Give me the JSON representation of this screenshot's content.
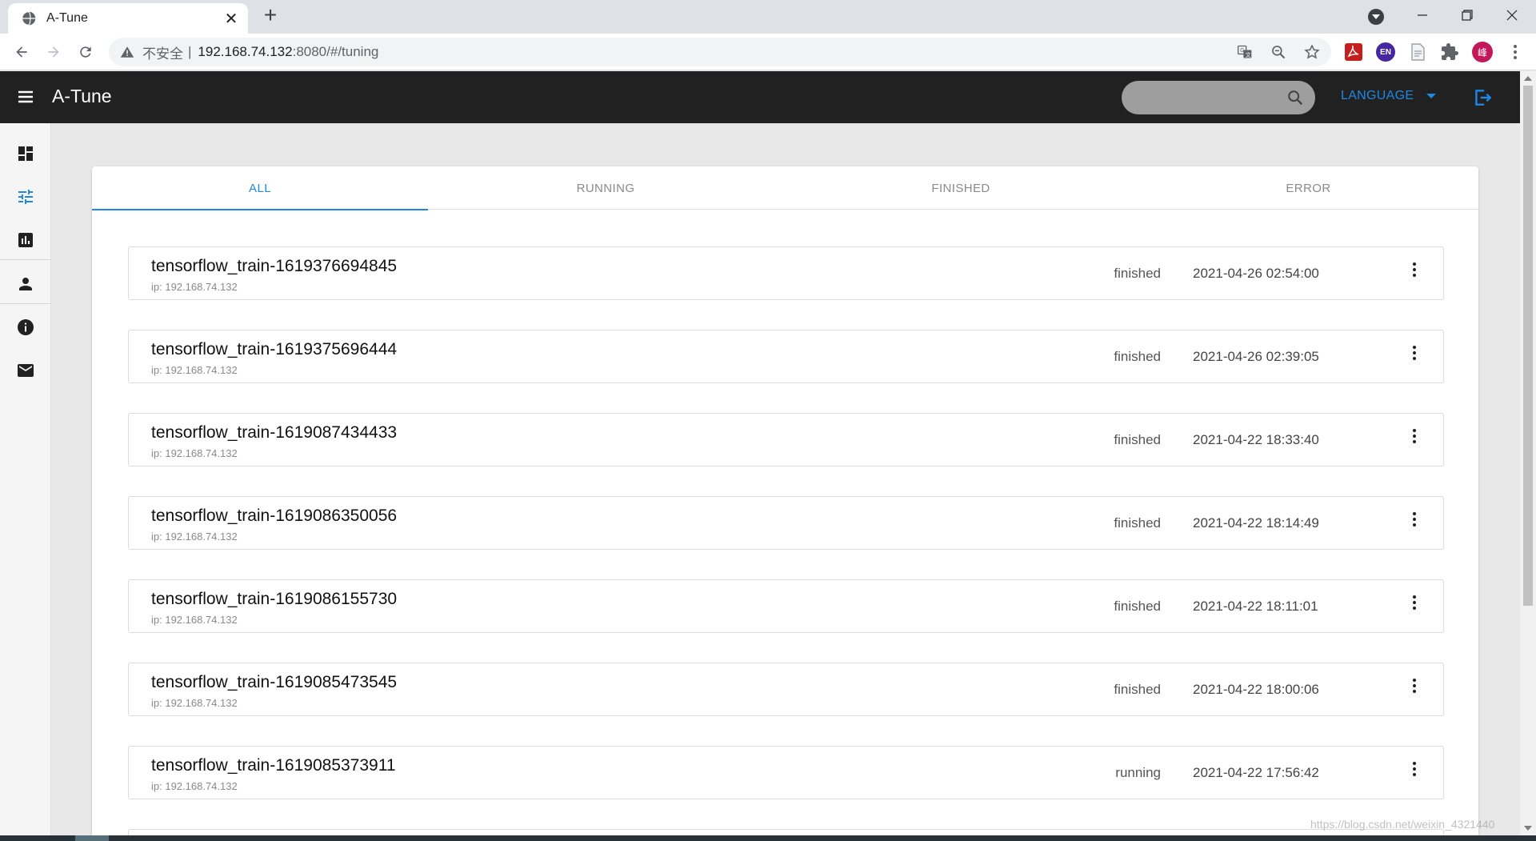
{
  "browser": {
    "tab_title": "A-Tune",
    "url_insecure_label": "不安全",
    "url_separator": "|",
    "url_host": "192.168.74.132",
    "url_path": ":8080/#/tuning",
    "icons": [
      "globe-icon",
      "close-icon",
      "plus-icon",
      "back-arrow-icon",
      "forward-arrow-icon",
      "reload-icon",
      "warning-icon",
      "translate-icon",
      "zoom-out-icon",
      "star-icon",
      "pdf-extension-icon",
      "en-extension-icon",
      "document-extension-icon",
      "puzzle-extension-icon",
      "profile-avatar",
      "more-vert-icon"
    ],
    "en_badge": "EN",
    "avatar_letter": "峰"
  },
  "app": {
    "title": "A-Tune",
    "language_label": "LANGUAGE",
    "sidebar_icons": [
      "dashboard-icon",
      "tune-icon",
      "chart-icon",
      "person-icon",
      "info-icon",
      "mail-icon"
    ]
  },
  "tabs": [
    {
      "label": "ALL",
      "active": true
    },
    {
      "label": "RUNNING",
      "active": false
    },
    {
      "label": "FINISHED",
      "active": false
    },
    {
      "label": "ERROR",
      "active": false
    }
  ],
  "rows": [
    {
      "name": "tensorflow_train-1619376694845",
      "ip": "ip: 192.168.74.132",
      "status": "finished",
      "time": "2021-04-26 02:54:00"
    },
    {
      "name": "tensorflow_train-1619375696444",
      "ip": "ip: 192.168.74.132",
      "status": "finished",
      "time": "2021-04-26 02:39:05"
    },
    {
      "name": "tensorflow_train-1619087434433",
      "ip": "ip: 192.168.74.132",
      "status": "finished",
      "time": "2021-04-22 18:33:40"
    },
    {
      "name": "tensorflow_train-1619086350056",
      "ip": "ip: 192.168.74.132",
      "status": "finished",
      "time": "2021-04-22 18:14:49"
    },
    {
      "name": "tensorflow_train-1619086155730",
      "ip": "ip: 192.168.74.132",
      "status": "finished",
      "time": "2021-04-22 18:11:01"
    },
    {
      "name": "tensorflow_train-1619085473545",
      "ip": "ip: 192.168.74.132",
      "status": "finished",
      "time": "2021-04-22 18:00:06"
    },
    {
      "name": "tensorflow_train-1619085373911",
      "ip": "ip: 192.168.74.132",
      "status": "running",
      "time": "2021-04-22 17:56:42"
    }
  ],
  "watermark": "https://blog.csdn.net/weixin_4321440",
  "colors": {
    "accent": "#1e88e5",
    "app_bar": "#212121"
  }
}
